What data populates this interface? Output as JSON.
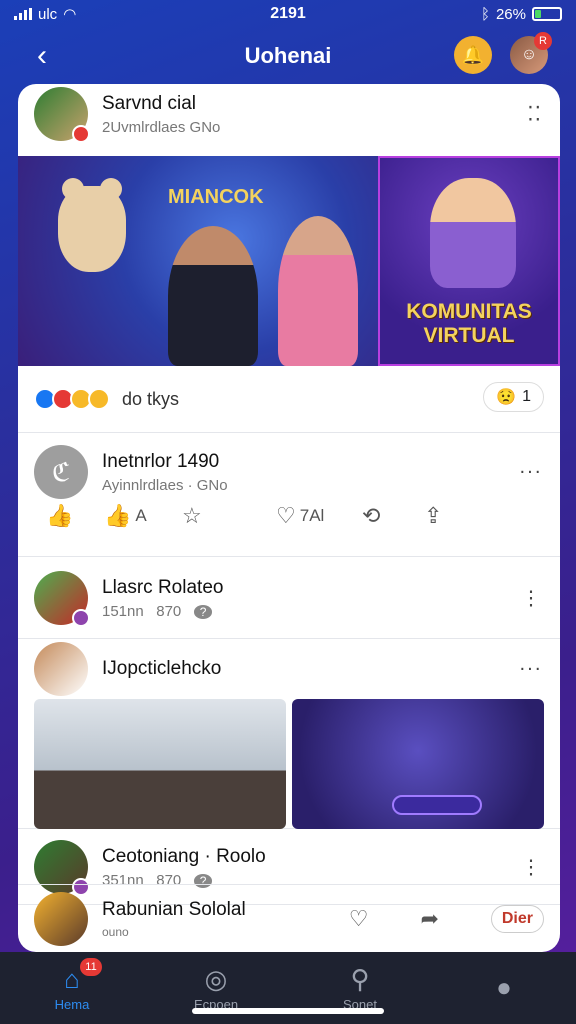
{
  "status": {
    "time": "2191",
    "carrier": "ulc",
    "battery": "26%"
  },
  "header": {
    "title": "Uohenai",
    "back_icon": "chevron-left-icon",
    "notifications_badge": "R"
  },
  "post1": {
    "name": "Sarvnd cial",
    "sub": "2Uvmlrdlaes GNo",
    "banner_brand": "MIANCOK",
    "banner_caption_line1": "KOMUNITAS",
    "banner_caption_line2": "VIRTUAL",
    "reactions_text": "do tkys",
    "reaction_pill_count": "1"
  },
  "post2": {
    "name": "Inetnrlor 1490",
    "sub": "Ayinnlrdlaes · GNo",
    "action_like_label": "A",
    "action_love_count": "7Al"
  },
  "post3": {
    "name": "Llasrc Rolateo",
    "meta_a": "151nn",
    "meta_b": "870",
    "meta_badge": "?"
  },
  "post4": {
    "name": "IJopcticlehcko"
  },
  "post5": {
    "name": "Ceotoniang · Roolo",
    "meta_a": "351nn",
    "meta_b": "870",
    "meta_badge": "?"
  },
  "post6": {
    "name": "Rabunian Sololal",
    "sub": "ouno",
    "sticker_text": "Dier"
  },
  "tabs": [
    {
      "label": "Hema",
      "icon": "home-icon",
      "badge": "11",
      "active": true
    },
    {
      "label": "Ecpoen",
      "icon": "search-circle-icon",
      "active": false
    },
    {
      "label": "Sonet",
      "icon": "search-icon",
      "active": false
    },
    {
      "label": "",
      "icon": "profile-icon",
      "active": false
    }
  ],
  "colors": {
    "accent": "#2d8cf0",
    "badge": "#e53935",
    "tabbar": "#1e2230"
  }
}
